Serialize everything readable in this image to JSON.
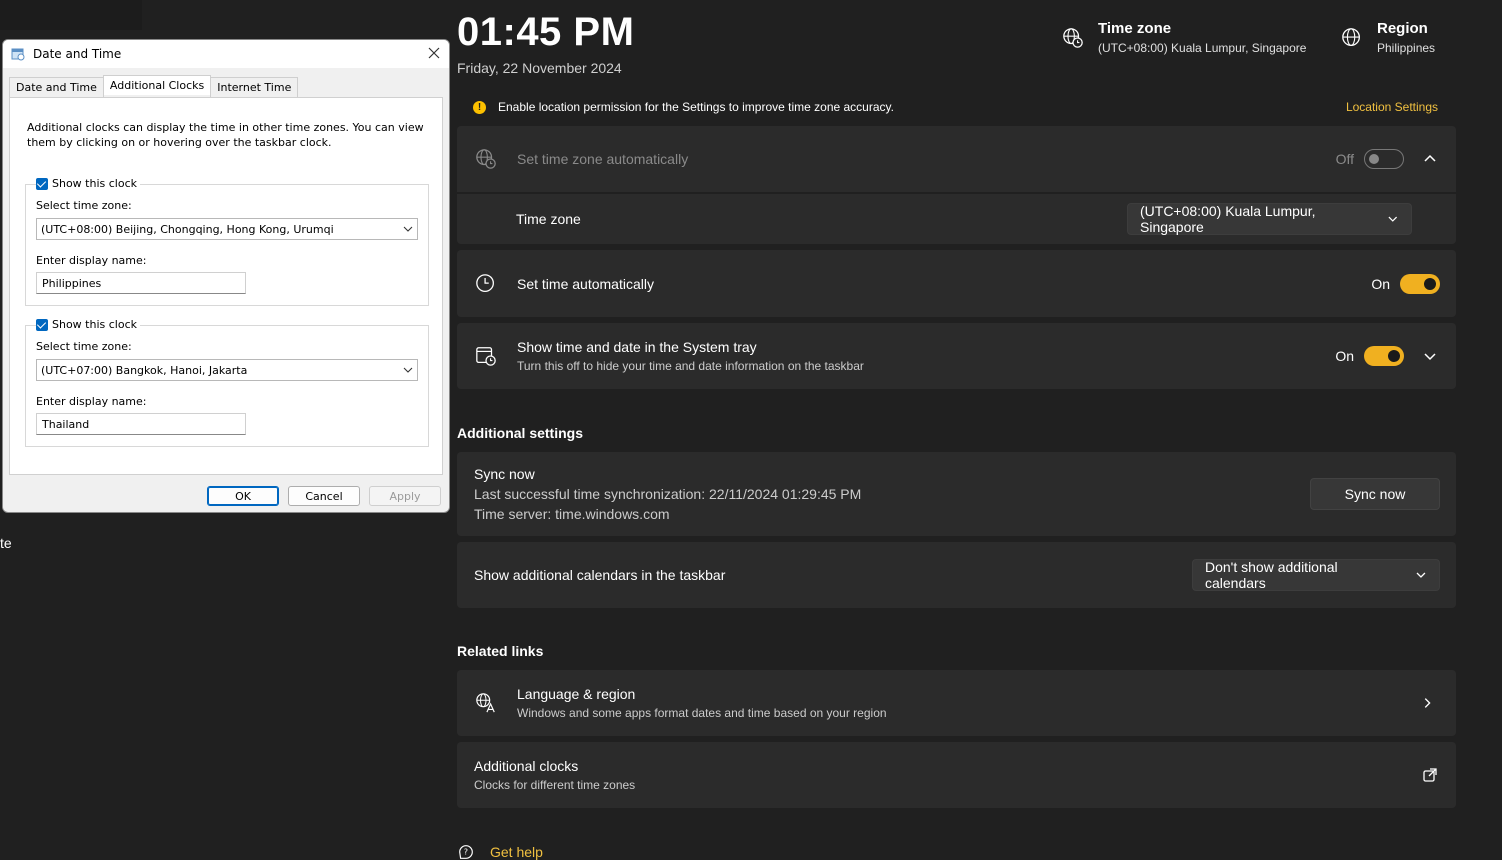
{
  "left": {
    "fragment": "te"
  },
  "header": {
    "time": "01:45 PM",
    "date": "Friday, 22 November 2024",
    "timezone_title": "Time zone",
    "timezone_value": "(UTC+08:00) Kuala Lumpur, Singapore",
    "region_title": "Region",
    "region_value": "Philippines"
  },
  "notice": {
    "text": "Enable location permission for the Settings to improve time zone accuracy.",
    "link": "Location Settings"
  },
  "settings": {
    "auto_tz": {
      "label": "Set time zone automatically",
      "state": "Off"
    },
    "timezone": {
      "label": "Time zone",
      "value": "(UTC+08:00) Kuala Lumpur, Singapore"
    },
    "auto_time": {
      "label": "Set time automatically",
      "state": "On"
    },
    "tray": {
      "label": "Show time and date in the System tray",
      "sub": "Turn this off to hide your time and date information on the taskbar",
      "state": "On"
    }
  },
  "additional": {
    "title": "Additional settings",
    "sync_title": "Sync now",
    "sync_last": "Last successful time synchronization: 22/11/2024 01:29:45 PM",
    "sync_server": "Time server: time.windows.com",
    "sync_button": "Sync now",
    "calendars_label": "Show additional calendars in the taskbar",
    "calendars_value": "Don't show additional calendars"
  },
  "related": {
    "title": "Related links",
    "lang_title": "Language & region",
    "lang_sub": "Windows and some apps format dates and time based on your region",
    "clocks_title": "Additional clocks",
    "clocks_sub": "Clocks for different time zones"
  },
  "help": {
    "label": "Get help"
  },
  "dialog": {
    "title": "Date and Time",
    "tabs": [
      "Date and Time",
      "Additional Clocks",
      "Internet Time"
    ],
    "description": "Additional clocks can display the time in other time zones. You can view them by clicking on or hovering over the taskbar clock.",
    "clock1": {
      "show_label": "Show this clock",
      "tz_label": "Select time zone:",
      "tz_value": "(UTC+08:00) Beijing, Chongqing, Hong Kong, Urumqi",
      "name_label": "Enter display name:",
      "name_value": "Philippines"
    },
    "clock2": {
      "show_label": "Show this clock",
      "tz_label": "Select time zone:",
      "tz_value": "(UTC+07:00) Bangkok, Hanoi, Jakarta",
      "name_label": "Enter display name:",
      "name_value": "Thailand"
    },
    "ok": "OK",
    "cancel": "Cancel",
    "apply": "Apply"
  },
  "colors": {
    "accent": "#f0b020",
    "background": "#202020",
    "card": "#2b2b2b",
    "link": "#f0c040",
    "dialog_accent": "#0067c0"
  }
}
